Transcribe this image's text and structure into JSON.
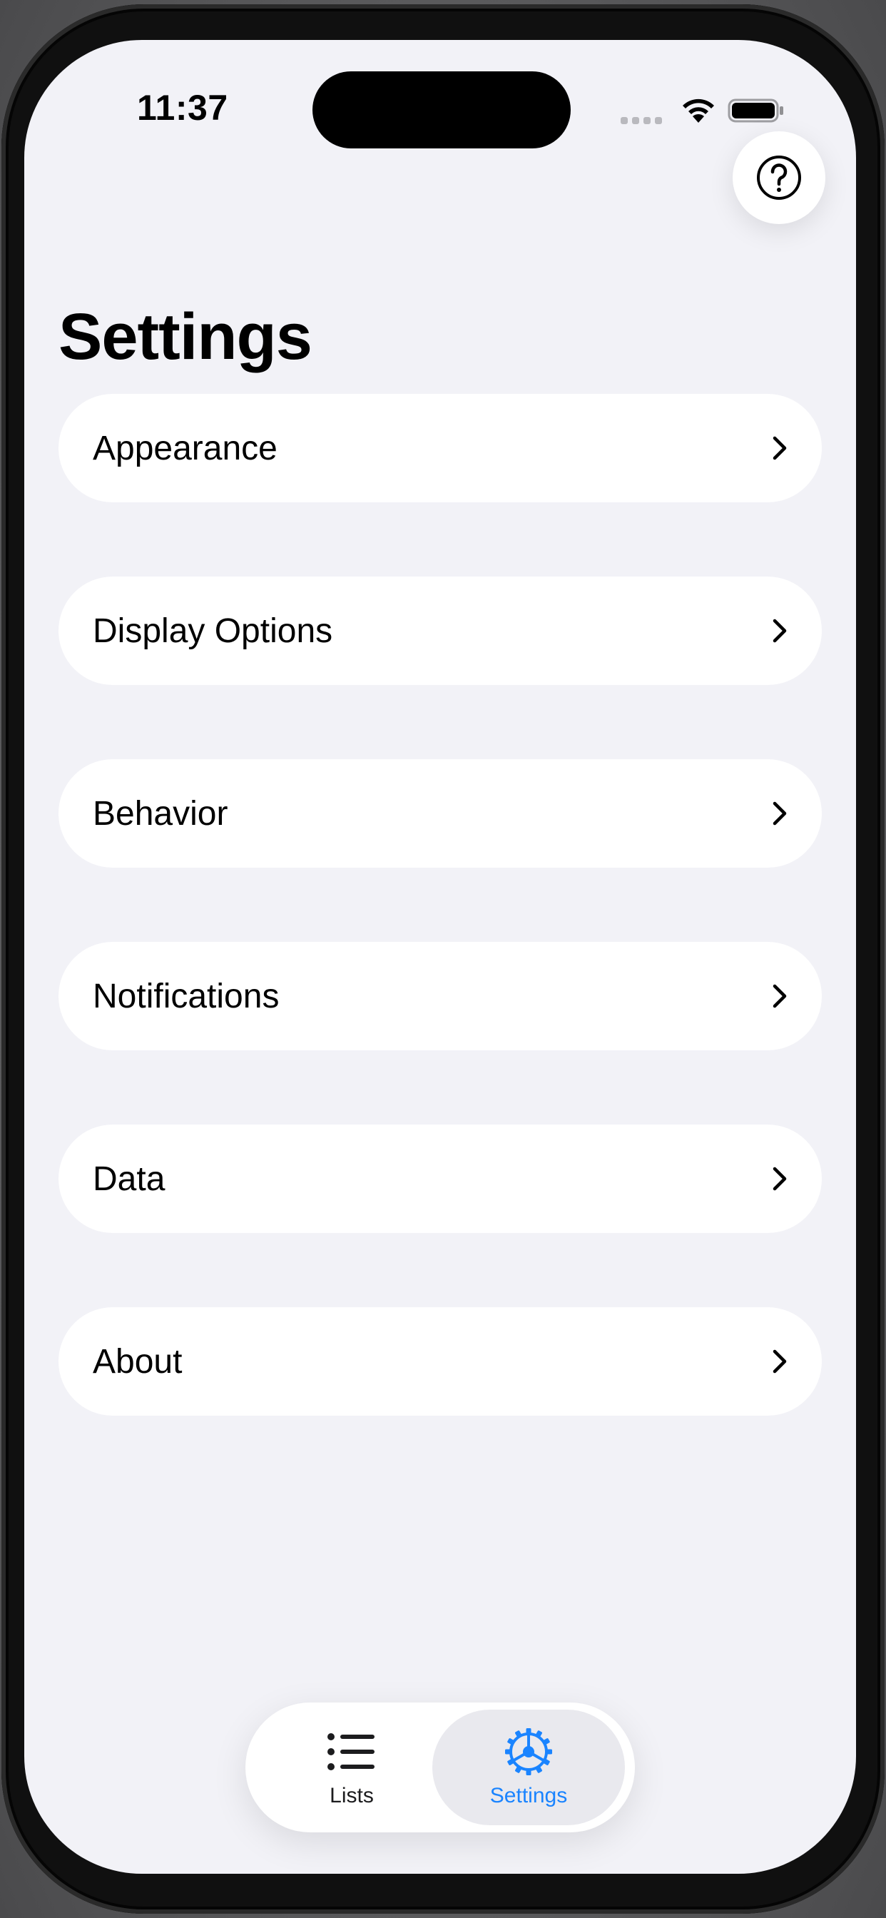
{
  "status_bar": {
    "time": "11:37"
  },
  "header": {
    "title": "Settings",
    "help_icon": "question-mark-circle-icon"
  },
  "settings_items": [
    {
      "label": "Appearance"
    },
    {
      "label": "Display Options"
    },
    {
      "label": "Behavior"
    },
    {
      "label": "Notifications"
    },
    {
      "label": "Data"
    },
    {
      "label": "About"
    }
  ],
  "tab_bar": {
    "tabs": [
      {
        "label": "Lists",
        "icon": "list-bullet-icon",
        "selected": false
      },
      {
        "label": "Settings",
        "icon": "gear-icon",
        "selected": true
      }
    ]
  },
  "colors": {
    "accent": "#1a84ff",
    "background": "#f2f2f7",
    "card": "#ffffff"
  }
}
